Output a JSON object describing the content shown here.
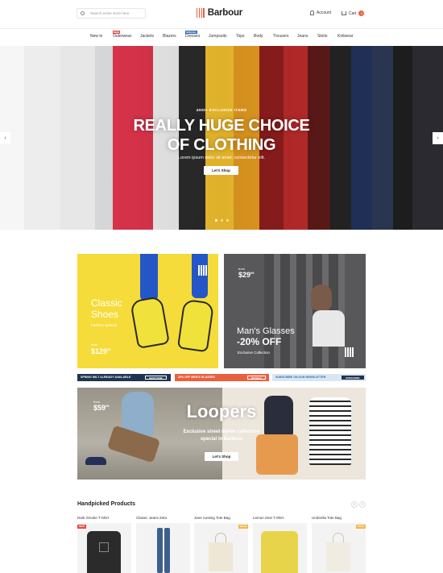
{
  "header": {
    "search_placeholder": "Search entire store here",
    "logo_text": "Barbour",
    "account_label": "Account",
    "cart_label": "Cart",
    "cart_count": "0",
    "accent_color": "#e9603f"
  },
  "nav": {
    "items": [
      {
        "label": "New in"
      },
      {
        "label": "Outerwear",
        "badge": "NEW"
      },
      {
        "label": "Jackets"
      },
      {
        "label": "Blazers"
      },
      {
        "label": "Dresses",
        "badge": "SPECIAL"
      },
      {
        "label": "Jumpsuits"
      },
      {
        "label": "Tops"
      },
      {
        "label": "Body"
      },
      {
        "label": "Trousers"
      },
      {
        "label": "Jeans"
      },
      {
        "label": "Skirts"
      },
      {
        "label": "Knitwear"
      }
    ]
  },
  "hero": {
    "subtitle": "4000+ EXCLUSIVE ITEMS",
    "title_line1": "REALLY HUGE CHOICE",
    "title_line2": "OF CLOTHING",
    "description": "Lorem ipsum dolor sit amet, consectetur elit.",
    "button_label": "Let's Shop",
    "prev_icon": "chevron-left-icon",
    "next_icon": "chevron-right-icon"
  },
  "banners": {
    "shoes": {
      "title_line1": "Classic",
      "title_line2": "Shoes",
      "subtitle": "Fashion Special",
      "from_label": "from",
      "price": "$129",
      "price_cents": "99"
    },
    "glasses": {
      "from_label": "from",
      "price": "$29",
      "price_cents": "99",
      "title": "Man's Glasses",
      "discount": "-20% OFF",
      "subtitle": "Exclusive Collection"
    },
    "promo_bar": [
      {
        "text": "SPRING WILT ALREADY AVAILABLE",
        "button": "SHOP NOW",
        "color": "#1e3450"
      },
      {
        "text": "20% OFF MEN'S GLASSES",
        "button": "DETAILS",
        "color": "#e9603f"
      },
      {
        "text": "SUBSCRIBE ON OUR NEWSLETTER",
        "button": "SUBSCRIBE",
        "color": "#2a6fb0"
      }
    ],
    "loopers": {
      "from_label": "from",
      "price": "$59",
      "price_cents": "99",
      "title": "Loopers",
      "line1": "Exclusive street denim collection",
      "line2": "special in Barbour",
      "button_label": "Let's Shop"
    }
  },
  "handpicked": {
    "title": "Handpicked Products",
    "products": [
      {
        "name": "Dark Smoke T-Shirt",
        "badge": "NEW",
        "badge_color": "#e9483f"
      },
      {
        "name": "Classic Jeans Zeta",
        "badge": "",
        "badge_color": ""
      },
      {
        "name": "Jane Austing Tote Bag",
        "badge": "SALE",
        "badge_color": "#f5b84a"
      },
      {
        "name": "Lemon Zest T-Shirt",
        "badge": "",
        "badge_color": ""
      },
      {
        "name": "Umbrella Tote Bag",
        "badge": "SALE",
        "badge_color": "#f5b84a"
      }
    ]
  }
}
